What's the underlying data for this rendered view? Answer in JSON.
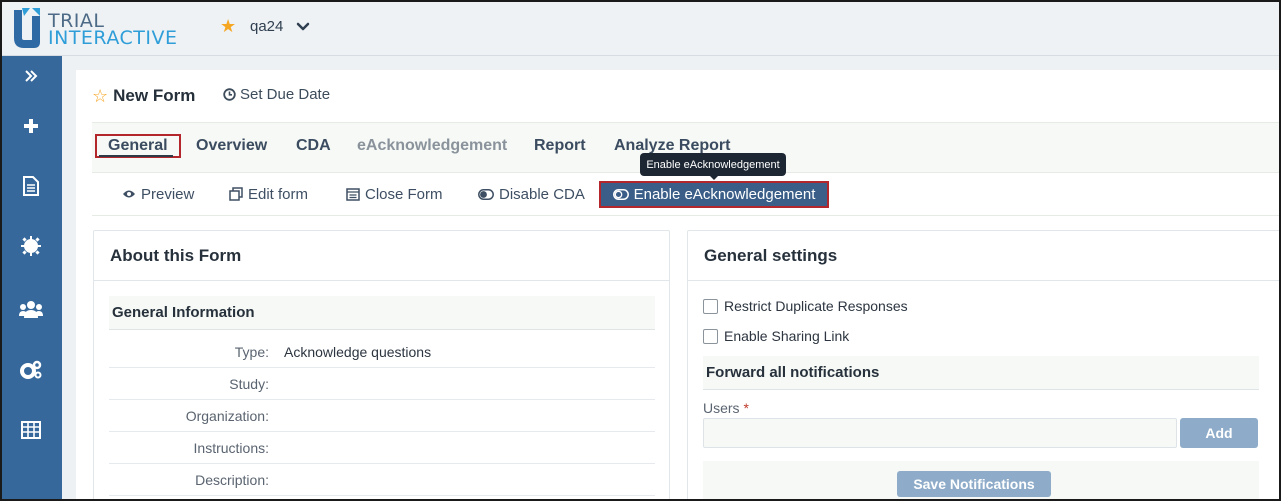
{
  "header": {
    "logo_line1": "TRIAL",
    "logo_line2": "INTERACTIVE",
    "study_name": "qa24"
  },
  "sidebar": {
    "items": [
      {
        "icon": "expand-chevrons-icon"
      },
      {
        "icon": "plus-icon"
      },
      {
        "icon": "document-icon"
      },
      {
        "icon": "gear-badge-icon"
      },
      {
        "icon": "users-icon"
      },
      {
        "icon": "cogs-icon"
      },
      {
        "icon": "table-icon"
      }
    ]
  },
  "form": {
    "title": "New Form",
    "due_date_label": "Set Due Date"
  },
  "tabs": [
    {
      "label": "General",
      "active": true
    },
    {
      "label": "Overview"
    },
    {
      "label": "CDA"
    },
    {
      "label": "eAcknowledgement",
      "disabled": true
    },
    {
      "label": "Report"
    },
    {
      "label": "Analyze Report"
    }
  ],
  "actions": {
    "preview": "Preview",
    "edit_form": "Edit form",
    "close_form": "Close Form",
    "disable_cda": "Disable CDA",
    "enable_eack": "Enable eAcknowledgement"
  },
  "tooltip": "Enable eAcknowledgement",
  "about": {
    "title": "About this Form",
    "section": "General Information",
    "rows": [
      {
        "label": "Type:",
        "value": "Acknowledge questions"
      },
      {
        "label": "Study:",
        "value": ""
      },
      {
        "label": "Organization:",
        "value": ""
      },
      {
        "label": "Instructions:",
        "value": ""
      },
      {
        "label": "Description:",
        "value": ""
      }
    ]
  },
  "settings": {
    "title": "General settings",
    "restrict_duplicates": "Restrict Duplicate Responses",
    "enable_sharing": "Enable Sharing Link",
    "notifications_title": "Forward all notifications",
    "users_label": "Users",
    "required_mark": "*",
    "add_button": "Add",
    "save_button": "Save Notifications"
  },
  "colors": {
    "sidebar": "#36689b",
    "primary_button": "#3a5e87",
    "highlight_border": "#b3262b",
    "star": "#f5a623",
    "disabled_button": "#8eacc9"
  }
}
